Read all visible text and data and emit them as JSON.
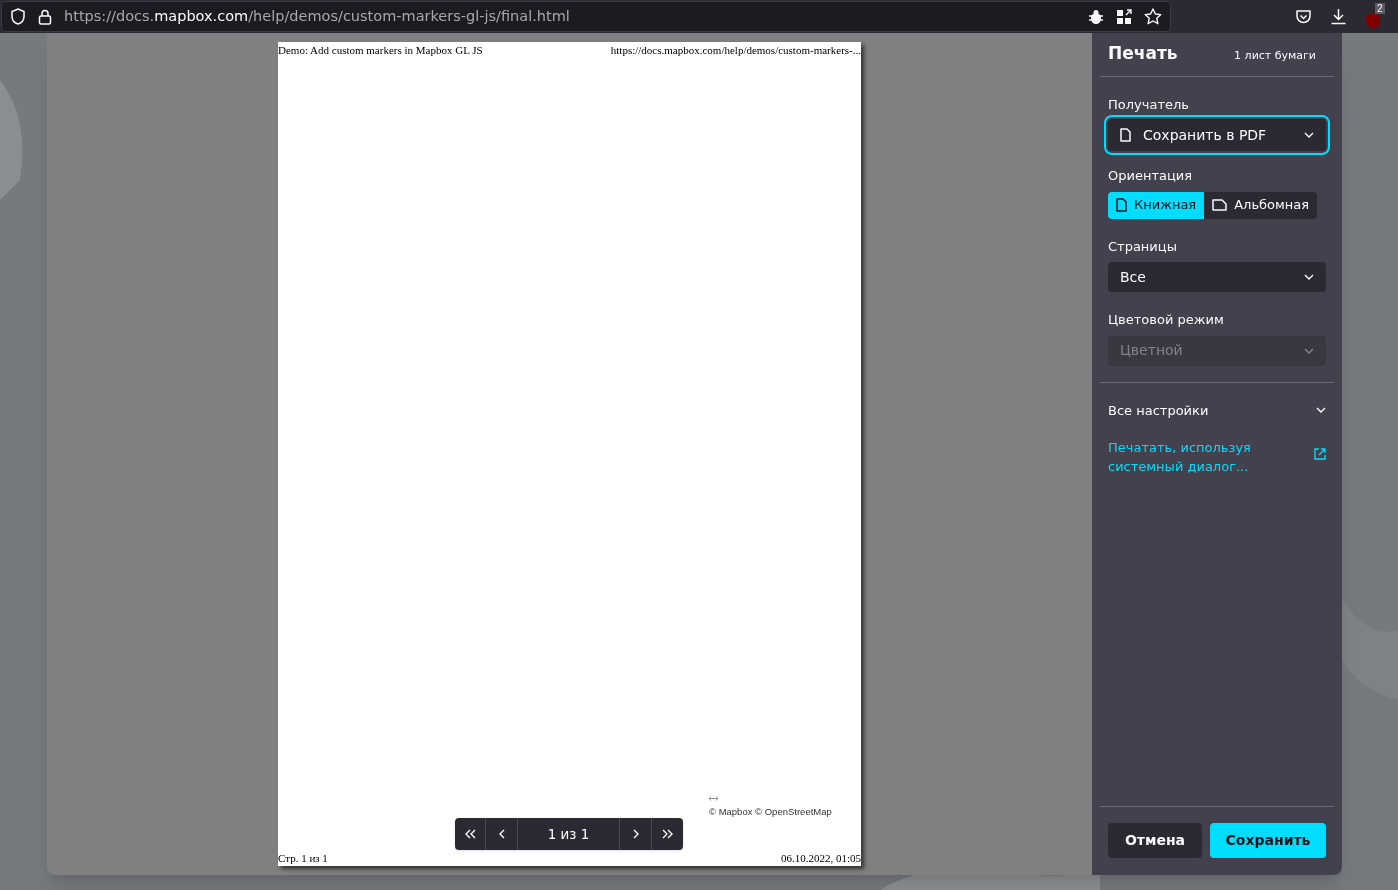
{
  "address_bar": {
    "url_prefix": "https://docs.",
    "url_domain": "mapbox.com",
    "url_path": "/help/demos/custom-markers-gl-js/final.html"
  },
  "toolbar": {
    "extension_badge": "2"
  },
  "preview": {
    "header_left": "Demo: Add custom markers in Mapbox GL JS",
    "header_right": "https://docs.mapbox.com/help/demos/custom-markers-...",
    "attribution": "© Mapbox © OpenStreetMap",
    "footer_left": "Стр. 1 из 1",
    "footer_right": "06.10.2022, 01:05",
    "pager": {
      "label": "1 из 1"
    }
  },
  "print_panel": {
    "title": "Печать",
    "sheet_count": "1 лист бумаги",
    "destination": {
      "label": "Получатель",
      "value": "Сохранить в PDF",
      "focused": true
    },
    "orientation": {
      "label": "Ориентация",
      "options": [
        {
          "label": "Книжная",
          "kind": "portrait",
          "selected": true
        },
        {
          "label": "Альбомная",
          "kind": "landscape",
          "selected": false
        }
      ]
    },
    "pages": {
      "label": "Страницы",
      "value": "Все",
      "disabled": false
    },
    "color_mode": {
      "label": "Цветовой режим",
      "value": "Цветной",
      "disabled": true
    },
    "more_settings": {
      "label": "Все настройки",
      "expanded": false
    },
    "system_dialog_link": "Печатать, используя системный диалог...",
    "buttons": [
      {
        "label": "Отмена",
        "kind": "secondary"
      },
      {
        "label": "Сохранить",
        "kind": "primary"
      }
    ]
  }
}
